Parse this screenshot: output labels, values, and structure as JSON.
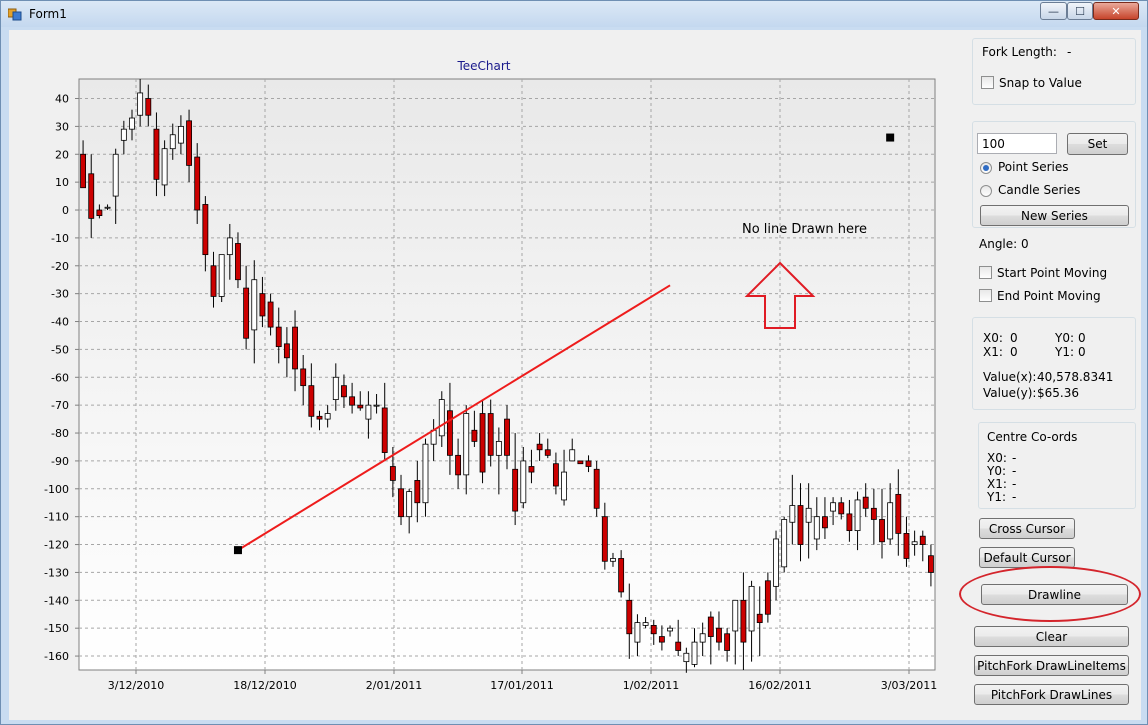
{
  "window": {
    "title": "Form1",
    "minimize_glyph": "—",
    "maximize_glyph": "☐",
    "close_glyph": "✕"
  },
  "chart": {
    "annotation": "No line Drawn here"
  },
  "chart_data": {
    "type": "candlestick",
    "title": "TeeChart",
    "xlabel": "",
    "ylabel": "",
    "ylim": [
      -165,
      47
    ],
    "y_ticks": [
      40,
      30,
      20,
      10,
      0,
      -10,
      -20,
      -30,
      -40,
      -50,
      -60,
      -70,
      -80,
      -90,
      -100,
      -110,
      -120,
      -130,
      -140,
      -150,
      -160
    ],
    "x_ticks": [
      "3/12/2010",
      "18/12/2010",
      "2/01/2011",
      "17/01/2011",
      "1/02/2011",
      "16/02/2011",
      "3/03/2011"
    ],
    "grid": true,
    "up_color": "#ffffff",
    "down_color": "#cc0000",
    "line_color": "#ee1c1c",
    "candles": [
      {
        "o": 20,
        "h": 25,
        "l": 10,
        "c": 8
      },
      {
        "o": 13,
        "h": 20,
        "l": -10,
        "c": -3
      },
      {
        "o": 0,
        "h": 2,
        "l": -3,
        "c": -2
      },
      {
        "o": 1,
        "h": 2,
        "l": 0,
        "c": 1
      },
      {
        "o": 5,
        "h": 22,
        "l": -5,
        "c": 20
      },
      {
        "o": 25,
        "h": 32,
        "l": 20,
        "c": 29
      },
      {
        "o": 29,
        "h": 36,
        "l": 25,
        "c": 33
      },
      {
        "o": 34,
        "h": 47,
        "l": 30,
        "c": 42
      },
      {
        "o": 40,
        "h": 45,
        "l": 30,
        "c": 34
      },
      {
        "o": 29,
        "h": 35,
        "l": 5,
        "c": 11
      },
      {
        "o": 9,
        "h": 25,
        "l": 5,
        "c": 22
      },
      {
        "o": 22,
        "h": 31,
        "l": 18,
        "c": 27
      },
      {
        "o": 24,
        "h": 34,
        "l": 20,
        "c": 30
      },
      {
        "o": 32,
        "h": 36,
        "l": 10,
        "c": 16
      },
      {
        "o": 19,
        "h": 24,
        "l": -5,
        "c": 0
      },
      {
        "o": 2,
        "h": 5,
        "l": -22,
        "c": -16
      },
      {
        "o": -20,
        "h": -15,
        "l": -35,
        "c": -31
      },
      {
        "o": -31,
        "h": -20,
        "l": -33,
        "c": -16
      },
      {
        "o": -16,
        "h": -5,
        "l": -25,
        "c": -10
      },
      {
        "o": -12,
        "h": -8,
        "l": -28,
        "c": -25
      },
      {
        "o": -28,
        "h": -20,
        "l": -50,
        "c": -46
      },
      {
        "o": -43,
        "h": -18,
        "l": -55,
        "c": -25
      },
      {
        "o": -30,
        "h": -24,
        "l": -42,
        "c": -38
      },
      {
        "o": -33,
        "h": -30,
        "l": -45,
        "c": -42
      },
      {
        "o": -42,
        "h": -35,
        "l": -55,
        "c": -49
      },
      {
        "o": -48,
        "h": -42,
        "l": -60,
        "c": -53
      },
      {
        "o": -42,
        "h": -36,
        "l": -65,
        "c": -57
      },
      {
        "o": -57,
        "h": -52,
        "l": -70,
        "c": -63
      },
      {
        "o": -63,
        "h": -55,
        "l": -78,
        "c": -74
      },
      {
        "o": -74,
        "h": -72,
        "l": -79,
        "c": -75
      },
      {
        "o": -75,
        "h": -70,
        "l": -78,
        "c": -73
      },
      {
        "o": -68,
        "h": -55,
        "l": -72,
        "c": -60
      },
      {
        "o": -63,
        "h": -59,
        "l": -71,
        "c": -67
      },
      {
        "o": -67,
        "h": -62,
        "l": -73,
        "c": -70
      },
      {
        "o": -70,
        "h": -65,
        "l": -72,
        "c": -71
      },
      {
        "o": -75,
        "h": -65,
        "l": -82,
        "c": -70
      },
      {
        "o": -70,
        "h": -66,
        "l": -73,
        "c": -70
      },
      {
        "o": -71,
        "h": -62,
        "l": -90,
        "c": -87
      },
      {
        "o": -92,
        "h": -85,
        "l": -103,
        "c": -97
      },
      {
        "o": -100,
        "h": -95,
        "l": -113,
        "c": -110
      },
      {
        "o": -110,
        "h": -100,
        "l": -116,
        "c": -101
      },
      {
        "o": -97,
        "h": -90,
        "l": -112,
        "c": -105
      },
      {
        "o": -105,
        "h": -82,
        "l": -110,
        "c": -84
      },
      {
        "o": -84,
        "h": -75,
        "l": -90,
        "c": -79
      },
      {
        "o": -81,
        "h": -65,
        "l": -85,
        "c": -68
      },
      {
        "o": -72,
        "h": -62,
        "l": -95,
        "c": -88
      },
      {
        "o": -88,
        "h": -82,
        "l": -100,
        "c": -95
      },
      {
        "o": -95,
        "h": -70,
        "l": -102,
        "c": -73
      },
      {
        "o": -79,
        "h": -72,
        "l": -85,
        "c": -83
      },
      {
        "o": -73,
        "h": -68,
        "l": -98,
        "c": -94
      },
      {
        "o": -73,
        "h": -68,
        "l": -92,
        "c": -88
      },
      {
        "o": -88,
        "h": -78,
        "l": -102,
        "c": -83
      },
      {
        "o": -75,
        "h": -70,
        "l": -93,
        "c": -88
      },
      {
        "o": -93,
        "h": -80,
        "l": -113,
        "c": -108
      },
      {
        "o": -105,
        "h": -85,
        "l": -107,
        "c": -90
      },
      {
        "o": -92,
        "h": -86,
        "l": -98,
        "c": -94
      },
      {
        "o": -84,
        "h": -80,
        "l": -90,
        "c": -86
      },
      {
        "o": -86,
        "h": -82,
        "l": -89,
        "c": -88
      },
      {
        "o": -91,
        "h": -87,
        "l": -102,
        "c": -99
      },
      {
        "o": -104,
        "h": -86,
        "l": -106,
        "c": -94
      },
      {
        "o": -90,
        "h": -82,
        "l": -90,
        "c": -86
      },
      {
        "o": -90,
        "h": -90,
        "l": -91,
        "c": -91
      },
      {
        "o": -90,
        "h": -88,
        "l": -94,
        "c": -92
      },
      {
        "o": -93,
        "h": -90,
        "l": -110,
        "c": -107
      },
      {
        "o": -110,
        "h": -105,
        "l": -129,
        "c": -126
      },
      {
        "o": -126,
        "h": -123,
        "l": -128,
        "c": -125
      },
      {
        "o": -125,
        "h": -122,
        "l": -139,
        "c": -137
      },
      {
        "o": -140,
        "h": -134,
        "l": -161,
        "c": -152
      },
      {
        "o": -155,
        "h": -145,
        "l": -160,
        "c": -148
      },
      {
        "o": -149,
        "h": -146,
        "l": -150,
        "c": -148
      },
      {
        "o": -149,
        "h": -147,
        "l": -156,
        "c": -152
      },
      {
        "o": -153,
        "h": -149,
        "l": -158,
        "c": -155
      },
      {
        "o": -151,
        "h": -149,
        "l": -153,
        "c": -150
      },
      {
        "o": -155,
        "h": -147,
        "l": -160,
        "c": -158
      },
      {
        "o": -162,
        "h": -157,
        "l": -166,
        "c": -159
      },
      {
        "o": -163,
        "h": -150,
        "l": -164,
        "c": -155
      },
      {
        "o": -155,
        "h": -148,
        "l": -160,
        "c": -152
      },
      {
        "o": -146,
        "h": -144,
        "l": -163,
        "c": -153
      },
      {
        "o": -150,
        "h": -144,
        "l": -158,
        "c": -155
      },
      {
        "o": -152,
        "h": -150,
        "l": -162,
        "c": -158
      },
      {
        "o": -151,
        "h": -144,
        "l": -163,
        "c": -140
      },
      {
        "o": -140,
        "h": -130,
        "l": -165,
        "c": -155
      },
      {
        "o": -151,
        "h": -133,
        "l": -162,
        "c": -135
      },
      {
        "o": -145,
        "h": -135,
        "l": -160,
        "c": -148
      },
      {
        "o": -133,
        "h": -130,
        "l": -148,
        "c": -145
      },
      {
        "o": -135,
        "h": -115,
        "l": -140,
        "c": -118
      },
      {
        "o": -128,
        "h": -110,
        "l": -130,
        "c": -111
      },
      {
        "o": -112,
        "h": -95,
        "l": -120,
        "c": -106
      },
      {
        "o": -106,
        "h": -98,
        "l": -126,
        "c": -120
      },
      {
        "o": -112,
        "h": -98,
        "l": -125,
        "c": -107
      },
      {
        "o": -118,
        "h": -103,
        "l": -122,
        "c": -110
      },
      {
        "o": -110,
        "h": -103,
        "l": -118,
        "c": -114
      },
      {
        "o": -108,
        "h": -103,
        "l": -113,
        "c": -105
      },
      {
        "o": -105,
        "h": -103,
        "l": -111,
        "c": -109
      },
      {
        "o": -109,
        "h": -104,
        "l": -119,
        "c": -115
      },
      {
        "o": -115,
        "h": -101,
        "l": -122,
        "c": -104
      },
      {
        "o": -103,
        "h": -98,
        "l": -110,
        "c": -107
      },
      {
        "o": -107,
        "h": -100,
        "l": -120,
        "c": -111
      },
      {
        "o": -111,
        "h": -100,
        "l": -125,
        "c": -119
      },
      {
        "o": -118,
        "h": -98,
        "l": -120,
        "c": -105
      },
      {
        "o": -102,
        "h": -93,
        "l": -124,
        "c": -116
      },
      {
        "o": -116,
        "h": -110,
        "l": -128,
        "c": -125
      },
      {
        "o": -120,
        "h": -115,
        "l": -124,
        "c": -119
      },
      {
        "o": -117,
        "h": -115,
        "l": -126,
        "c": -120
      },
      {
        "o": -124,
        "h": -120,
        "l": -135,
        "c": -130
      }
    ],
    "drawn_line": {
      "start_index": 19,
      "start_value": -122,
      "end_index": 72,
      "end_value": -27
    },
    "floating_marker": {
      "index": 99,
      "value": 26
    }
  },
  "panel": {
    "fork_length_label": "Fork Length:",
    "fork_length_value": "-",
    "snap_label": "Snap to Value",
    "value_input": "100",
    "set_button": "Set",
    "point_series_label": "Point Series",
    "candle_series_label": "Candle Series",
    "new_series_button": "New Series",
    "angle_label": "Angle:",
    "angle_value": "0",
    "start_moving_label": "Start Point Moving",
    "end_moving_label": "End Point Moving",
    "x0_label": "X0:",
    "x0_value": "0",
    "y0_label": "Y0:",
    "y0_value": "0",
    "x1_label": "X1:",
    "x1_value": "0",
    "y1_label": "Y1:",
    "y1_value": "0",
    "valuex_label": "Value(x):",
    "valuex_value": "40,578.8341",
    "valuey_label": "Value(y):",
    "valuey_value": "$65.36",
    "centre_title": "Centre Co-ords",
    "cx0_label": "X0:",
    "cx0_value": "-",
    "cy0_label": "Y0:",
    "cy0_value": "-",
    "cx1_label": "X1:",
    "cx1_value": "-",
    "cy1_label": "Y1:",
    "cy1_value": "-",
    "cross_cursor_button": "Cross Cursor",
    "default_cursor_button": "Default Cursor",
    "drawline_button": "Drawline",
    "clear_button": "Clear",
    "pitchfork_items_button": "PitchFork DrawLineItems",
    "pitchfork_lines_button": "PitchFork DrawLines"
  },
  "colors": {
    "window_border": "#6f8fb3",
    "highlight_ring": "#d4252c",
    "chart_title": "#1a1a8c",
    "arrow": "#e01b24"
  }
}
